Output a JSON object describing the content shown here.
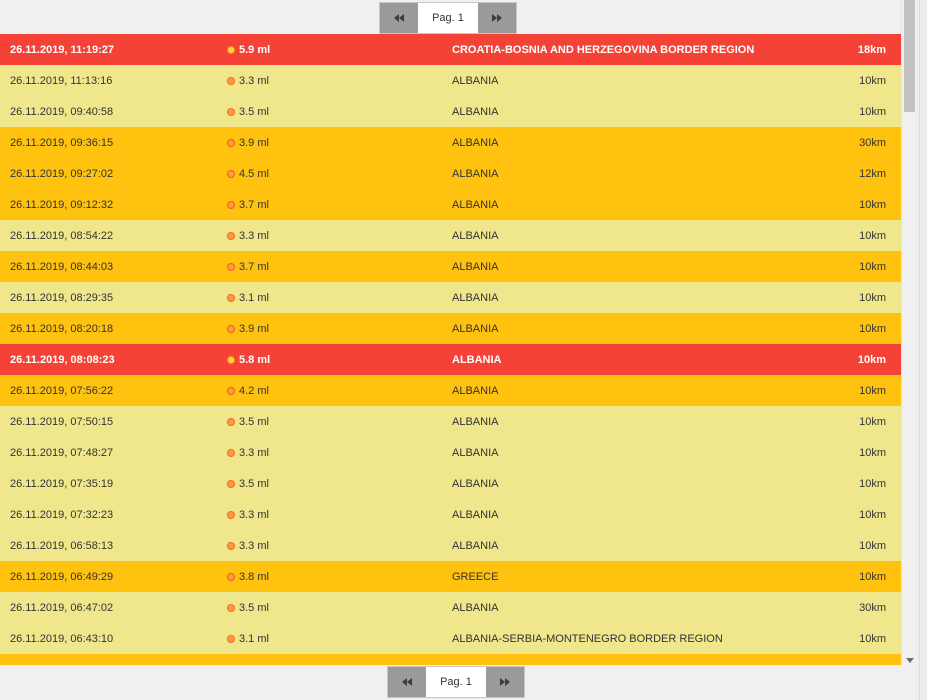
{
  "pagination": {
    "page_label": "Pag. 1",
    "prev_icon": "double-chevron-left-icon",
    "next_icon": "double-chevron-right-icon"
  },
  "colors": {
    "low": "#f0e68c",
    "mid": "#ffc20e",
    "high": "#f44336"
  },
  "events": [
    {
      "datetime": "26.11.2019, 11:19:27",
      "magnitude": "5.9 ml",
      "region": "CROATIA-BOSNIA AND HERZEGOVINA BORDER REGION",
      "depth": "18km",
      "level": "high"
    },
    {
      "datetime": "26.11.2019, 11:13:16",
      "magnitude": "3.3 ml",
      "region": "ALBANIA",
      "depth": "10km",
      "level": "low"
    },
    {
      "datetime": "26.11.2019, 09:40:58",
      "magnitude": "3.5 ml",
      "region": "ALBANIA",
      "depth": "10km",
      "level": "low"
    },
    {
      "datetime": "26.11.2019, 09:36:15",
      "magnitude": "3.9 ml",
      "region": "ALBANIA",
      "depth": "30km",
      "level": "mid"
    },
    {
      "datetime": "26.11.2019, 09:27:02",
      "magnitude": "4.5 ml",
      "region": "ALBANIA",
      "depth": "12km",
      "level": "mid"
    },
    {
      "datetime": "26.11.2019, 09:12:32",
      "magnitude": "3.7 ml",
      "region": "ALBANIA",
      "depth": "10km",
      "level": "mid"
    },
    {
      "datetime": "26.11.2019, 08:54:22",
      "magnitude": "3.3 ml",
      "region": "ALBANIA",
      "depth": "10km",
      "level": "low"
    },
    {
      "datetime": "26.11.2019, 08:44:03",
      "magnitude": "3.7 ml",
      "region": "ALBANIA",
      "depth": "10km",
      "level": "mid"
    },
    {
      "datetime": "26.11.2019, 08:29:35",
      "magnitude": "3.1 ml",
      "region": "ALBANIA",
      "depth": "10km",
      "level": "low"
    },
    {
      "datetime": "26.11.2019, 08:20:18",
      "magnitude": "3.9 ml",
      "region": "ALBANIA",
      "depth": "10km",
      "level": "mid"
    },
    {
      "datetime": "26.11.2019, 08:08:23",
      "magnitude": "5.8 ml",
      "region": "ALBANIA",
      "depth": "10km",
      "level": "high"
    },
    {
      "datetime": "26.11.2019, 07:56:22",
      "magnitude": "4.2 ml",
      "region": "ALBANIA",
      "depth": "10km",
      "level": "mid"
    },
    {
      "datetime": "26.11.2019, 07:50:15",
      "magnitude": "3.5 ml",
      "region": "ALBANIA",
      "depth": "10km",
      "level": "low"
    },
    {
      "datetime": "26.11.2019, 07:48:27",
      "magnitude": "3.3 ml",
      "region": "ALBANIA",
      "depth": "10km",
      "level": "low"
    },
    {
      "datetime": "26.11.2019, 07:35:19",
      "magnitude": "3.5 ml",
      "region": "ALBANIA",
      "depth": "10km",
      "level": "low"
    },
    {
      "datetime": "26.11.2019, 07:32:23",
      "magnitude": "3.3 ml",
      "region": "ALBANIA",
      "depth": "10km",
      "level": "low"
    },
    {
      "datetime": "26.11.2019, 06:58:13",
      "magnitude": "3.3 ml",
      "region": "ALBANIA",
      "depth": "10km",
      "level": "low"
    },
    {
      "datetime": "26.11.2019, 06:49:29",
      "magnitude": "3.8 ml",
      "region": "GREECE",
      "depth": "10km",
      "level": "mid"
    },
    {
      "datetime": "26.11.2019, 06:47:02",
      "magnitude": "3.5 ml",
      "region": "ALBANIA",
      "depth": "30km",
      "level": "low"
    },
    {
      "datetime": "26.11.2019, 06:43:10",
      "magnitude": "3.1 ml",
      "region": "ALBANIA-SERBIA-MONTENEGRO BORDER REGION",
      "depth": "10km",
      "level": "low"
    },
    {
      "datetime": "",
      "magnitude": "",
      "region": "",
      "depth": "",
      "level": "mid"
    }
  ]
}
